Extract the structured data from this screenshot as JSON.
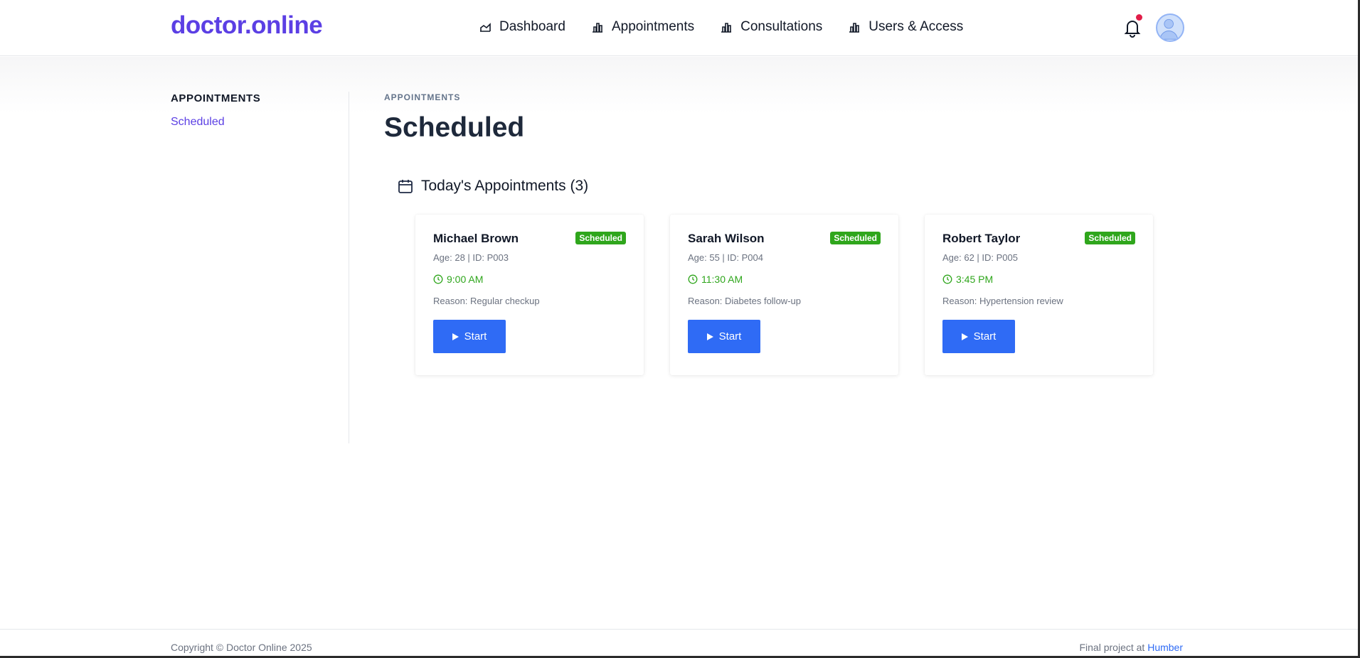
{
  "brand": {
    "logo": "doctor.online",
    "accent": "#5b3fe4"
  },
  "nav": {
    "items": [
      {
        "label": "Dashboard",
        "icon": "chart-area-icon"
      },
      {
        "label": "Appointments",
        "icon": "bar-chart-icon"
      },
      {
        "label": "Consultations",
        "icon": "bar-chart-icon"
      },
      {
        "label": "Users & Access",
        "icon": "bar-chart-icon"
      }
    ],
    "notification_icon": "bell-icon",
    "has_unread_notifications": true
  },
  "sidebar": {
    "title": "APPOINTMENTS",
    "items": [
      {
        "label": "Scheduled"
      }
    ]
  },
  "main": {
    "breadcrumb": "APPOINTMENTS",
    "title": "Scheduled",
    "section_title": "Today's Appointments (3)",
    "section_icon": "calendar-icon"
  },
  "appointments": [
    {
      "name": "Michael Brown",
      "status": "Scheduled",
      "meta": "Age: 28 | ID: P003",
      "time": "9:00 AM",
      "reason": "Reason: Regular checkup",
      "action": "Start"
    },
    {
      "name": "Sarah Wilson",
      "status": "Scheduled",
      "meta": "Age: 55 | ID: P004",
      "time": "11:30 AM",
      "reason": "Reason: Diabetes follow-up",
      "action": "Start"
    },
    {
      "name": "Robert Taylor",
      "status": "Scheduled",
      "meta": "Age: 62 | ID: P005",
      "time": "3:45 PM",
      "reason": "Reason: Hypertension review",
      "action": "Start"
    }
  ],
  "colors": {
    "status_green": "#2fa61c",
    "button_blue": "#2f6bf5"
  },
  "footer": {
    "copyright": "Copyright © Doctor Online 2025",
    "project_prefix": "Final project at",
    "project_link": "Humber"
  }
}
